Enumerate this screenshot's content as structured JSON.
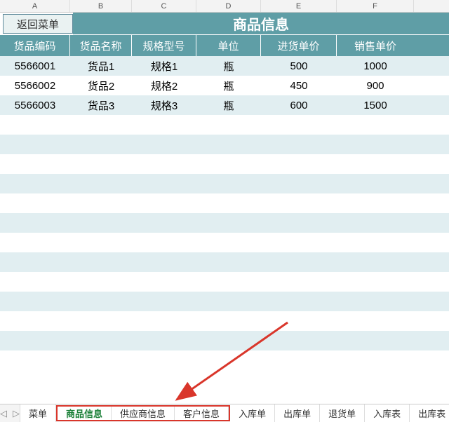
{
  "colLetters": [
    "A",
    "B",
    "C",
    "D",
    "E",
    "F"
  ],
  "ui": {
    "return_label": "返回菜单",
    "title": "商品信息"
  },
  "headers": {
    "code": "货品编码",
    "name": "货品名称",
    "spec": "规格型号",
    "unit": "单位",
    "purchase": "进货单价",
    "sale": "销售单价"
  },
  "rows": [
    {
      "code": "5566001",
      "name": "货品1",
      "spec": "规格1",
      "unit": "瓶",
      "purchase": "500",
      "sale": "1000"
    },
    {
      "code": "5566002",
      "name": "货品2",
      "spec": "规格2",
      "unit": "瓶",
      "purchase": "450",
      "sale": "900"
    },
    {
      "code": "5566003",
      "name": "货品3",
      "spec": "规格3",
      "unit": "瓶",
      "purchase": "600",
      "sale": "1500"
    }
  ],
  "tabs": {
    "nav_prev": "◁",
    "nav_next": "▷",
    "items": [
      {
        "label": "菜单",
        "highlight": false,
        "active": false
      },
      {
        "label": "商品信息",
        "highlight": true,
        "active": true
      },
      {
        "label": "供应商信息",
        "highlight": true,
        "active": false
      },
      {
        "label": "客户信息",
        "highlight": true,
        "active": false
      },
      {
        "label": "入库单",
        "highlight": false,
        "active": false
      },
      {
        "label": "出库单",
        "highlight": false,
        "active": false
      },
      {
        "label": "退货单",
        "highlight": false,
        "active": false
      },
      {
        "label": "入库表",
        "highlight": false,
        "active": false
      },
      {
        "label": "出库表",
        "highlight": false,
        "active": false
      }
    ]
  }
}
